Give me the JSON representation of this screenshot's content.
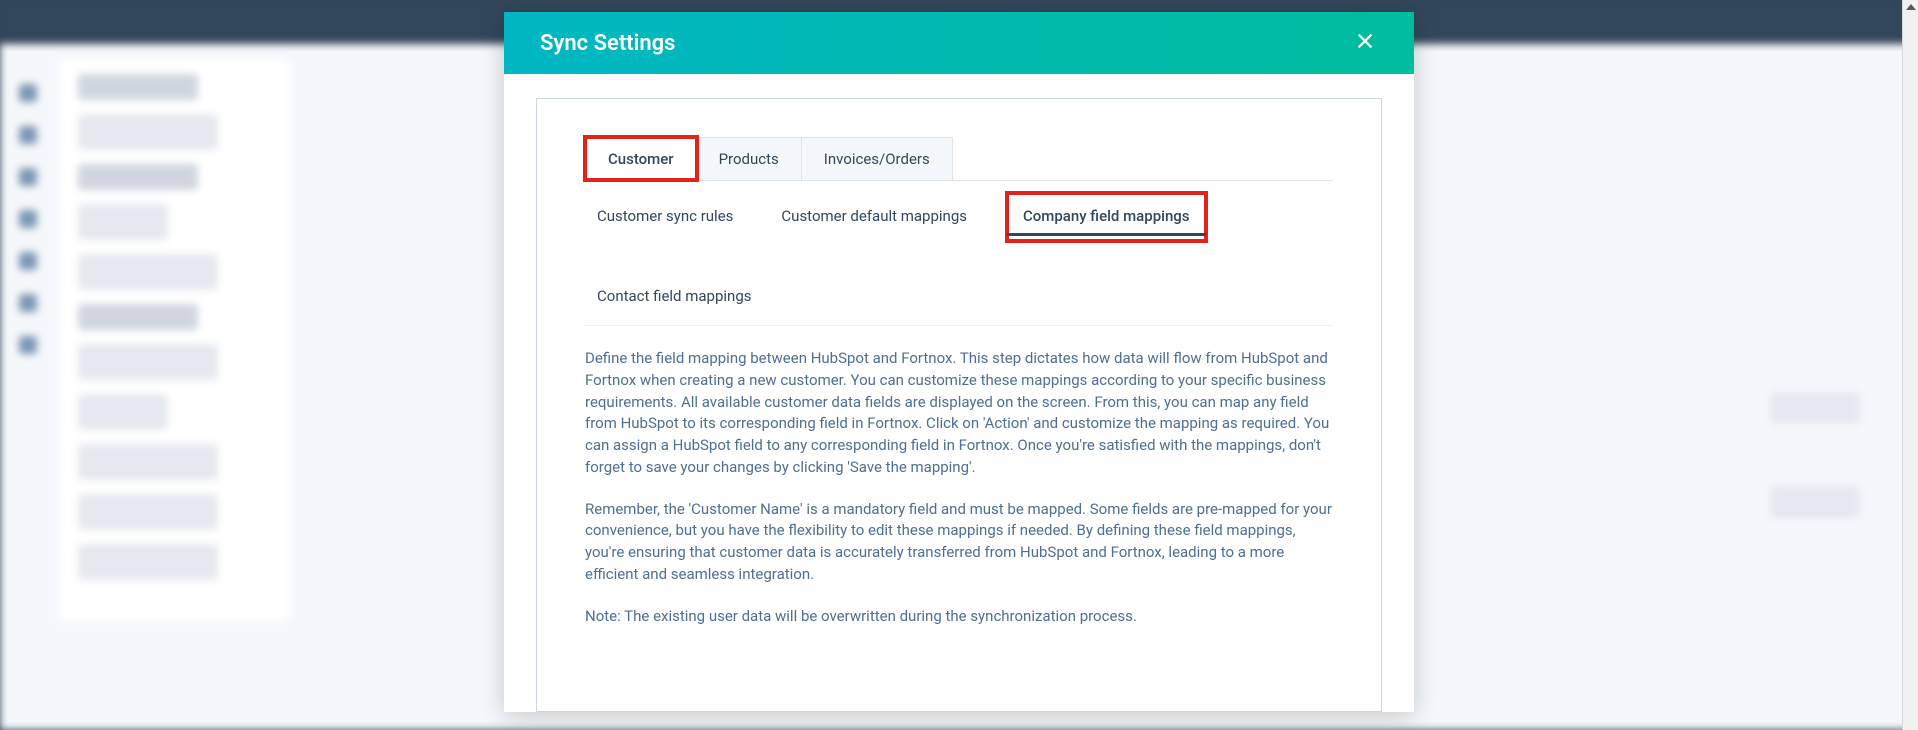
{
  "modal": {
    "title": "Sync Settings",
    "close_aria": "Close"
  },
  "tabs": {
    "customer": "Customer",
    "products": "Products",
    "invoices": "Invoices/Orders"
  },
  "subtabs": {
    "sync_rules": "Customer sync rules",
    "default_mappings": "Customer default mappings",
    "company_field_mappings": "Company field mappings",
    "contact_field_mappings": "Contact field mappings"
  },
  "description": {
    "p1": "Define the field mapping between HubSpot and Fortnox. This step dictates how data will flow from HubSpot and Fortnox when creating a new customer. You can customize these mappings according to your specific business requirements. All available customer data fields are displayed on the screen. From this, you can map any field from HubSpot to its corresponding field in Fortnox. Click on 'Action' and customize the mapping as required. You can assign a HubSpot field to any corresponding field in Fortnox. Once you're satisfied with the mappings, don't forget to save your changes by clicking 'Save the mapping'.",
    "p2": "Remember, the 'Customer Name' is a mandatory field and must be mapped. Some fields are pre-mapped for your convenience, but you have the flexibility to edit these mappings if needed. By defining these field mappings, you're ensuring that customer data is accurately transferred from HubSpot and Fortnox, leading to a more efficient and seamless integration.",
    "p3": "Note: The existing user data will be overwritten during the synchronization process."
  },
  "highlight_color": "#e2231a"
}
